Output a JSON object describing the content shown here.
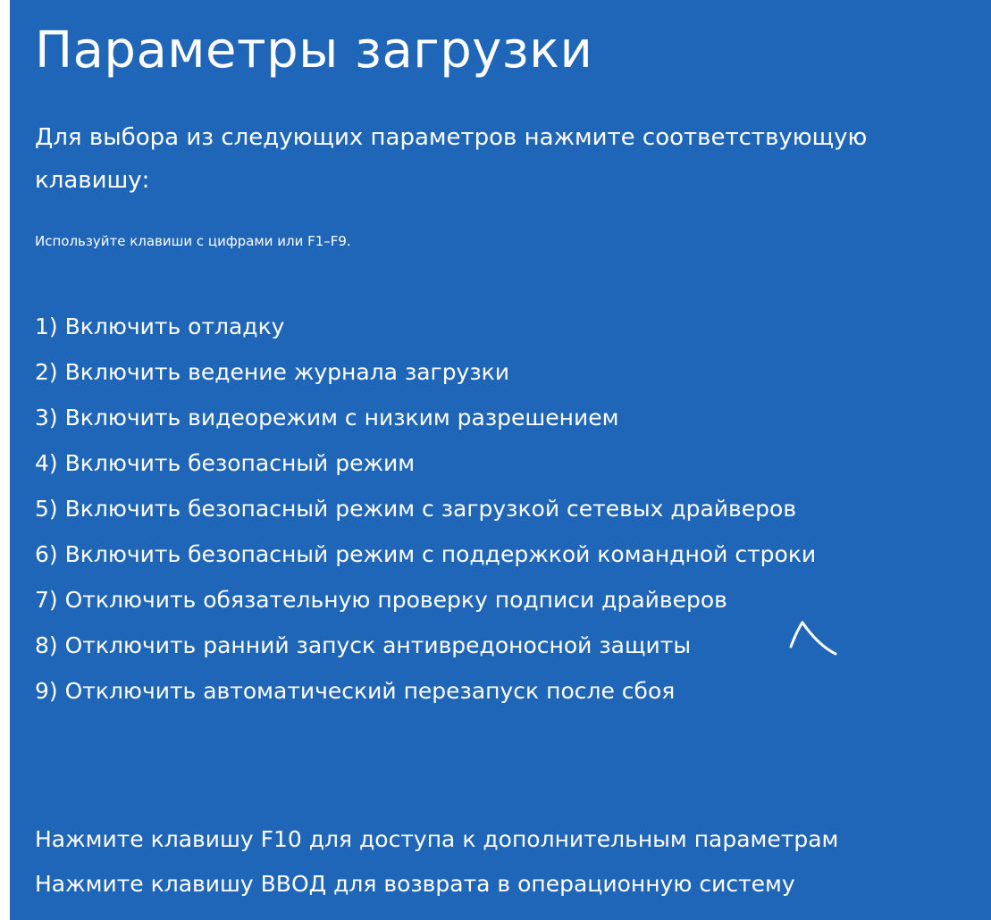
{
  "screen": {
    "title": "Параметры загрузки",
    "subtitle": "Для выбора из следующих параметров нажмите соответствующую клавишу:",
    "hint": "Используйте клавиши с цифрами или F1–F9.",
    "options": [
      "1) Включить отладку",
      "2) Включить ведение журнала загрузки",
      "3) Включить видеорежим с низким разрешением",
      "4) Включить безопасный режим",
      "5) Включить безопасный режим с загрузкой сетевых драйверов",
      "6) Включить безопасный режим с поддержкой командной строки",
      "7) Отключить обязательную проверку подписи драйверов",
      "8) Отключить ранний запуск антивредоносной защиты",
      "9) Отключить автоматический перезапуск после сбоя"
    ],
    "footer": {
      "advanced": "Нажмите клавишу F10 для доступа к дополнительным параметрам",
      "return": "Нажмите клавишу ВВОД для возврата в операционную систему"
    }
  },
  "colors": {
    "background": "#2066b8",
    "text": "#ffffff"
  },
  "icons": {
    "annotation": "hand-drawn-arrow-icon"
  }
}
